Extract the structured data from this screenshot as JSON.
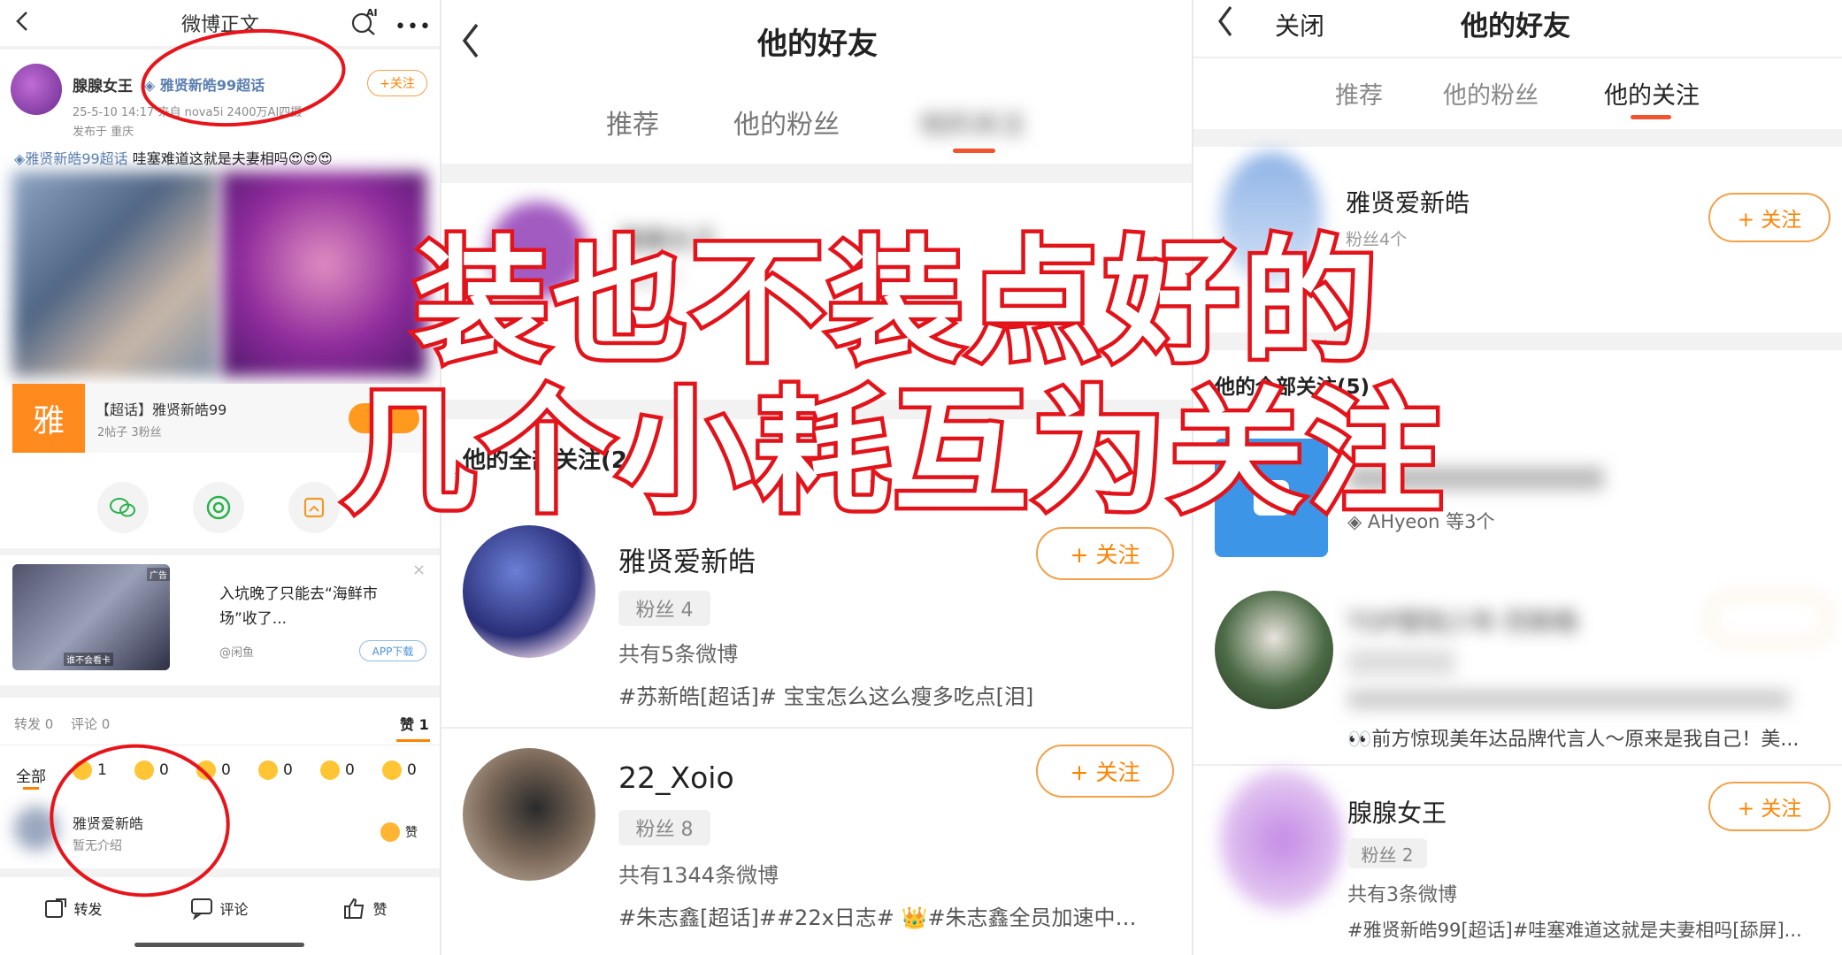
{
  "left_panel": {
    "header_title": "微博正文",
    "ai_label": "AI",
    "author_name": "腺腺女王",
    "topic_badge": "雅贤新皓99超话",
    "follow_label": "+关注",
    "post_meta": "25-5-10 14:17  来自 nova5i 2400万AI四摄",
    "post_location": "发布于 重庆",
    "post_text_topic": "雅贤新皓99超话",
    "post_text": " 哇塞难道这就是夫妻相吗😍😍😍",
    "supertopic_icon_char": "雅",
    "supertopic_title": "【超话】雅贤新皓99",
    "supertopic_stats": "2帖子 3粉丝",
    "ad_tag": "广告",
    "ad_title": "入坑晚了只能去“海鲜市场”收了...",
    "ad_source": "@闲鱼",
    "ad_button": "APP下载",
    "ad_img_caption": "谁不会看卡",
    "repost_count": "转发 0",
    "comment_count": "评论 0",
    "like_count": "赞 1",
    "filter_all": "全部",
    "reaction_counts": [
      "1",
      "0",
      "0",
      "0",
      "0",
      "0"
    ],
    "liker_name": "雅贤爱新皓",
    "liker_bio": "暂无介绍",
    "liker_like": "赞",
    "bottom_repost": "转发",
    "bottom_comment": "评论",
    "bottom_like": "赞"
  },
  "middle_panel": {
    "title": "他的好友",
    "tabs": [
      "推荐",
      "他的粉丝",
      "他的关注"
    ],
    "partial_name": "腺腺女王",
    "partial_meta": "粉丝2个",
    "section_heading": "他的全部关注(2)",
    "users": [
      {
        "name": "雅贤爱新皓",
        "fans": "粉丝 4",
        "posts": "共有5条微博",
        "latest": "#苏新皓[超话]# 宝宝怎么这么瘦多吃点[泪]",
        "follow": "+ 关注"
      },
      {
        "name": "22_Xoio",
        "fans": "粉丝 8",
        "posts": "共有1344条微博",
        "latest": "#朱志鑫[超话]##22x日志# 👑#朱志鑫全员加速中…",
        "follow": "+ 关注"
      }
    ]
  },
  "right_panel": {
    "close_label": "关闭",
    "title": "他的好友",
    "tabs": [
      "推荐",
      "他的粉丝",
      "他的关注"
    ],
    "top_user_name": "雅贤爱新皓",
    "top_user_meta": "粉丝4个",
    "top_follow": "+ 关注",
    "section_heading": "他的全部关注(5)",
    "group_meta": "AHyeon 等3个",
    "user3_name": "TOP登陆少年·苏新皓",
    "user3_latest": "👀前方惊现美年达品牌代言人～原来是我自己！美...",
    "user4_name": "腺腺女王",
    "user4_fans": "粉丝 2",
    "user4_posts": "共有3条微博",
    "user4_latest": "#雅贤新皓99[超话]#哇塞难道这就是夫妻相吗[舔屏]...",
    "user4_follow": "+ 关注"
  },
  "overlay": {
    "line1": "装也不装点好的",
    "line2": "几个小耗互为关注"
  },
  "colors": {
    "accent": "#ff8200",
    "overlay_stroke": "#e8141b",
    "annotation_circle": "#e8141b",
    "tab_indicator": "#f2542d"
  }
}
